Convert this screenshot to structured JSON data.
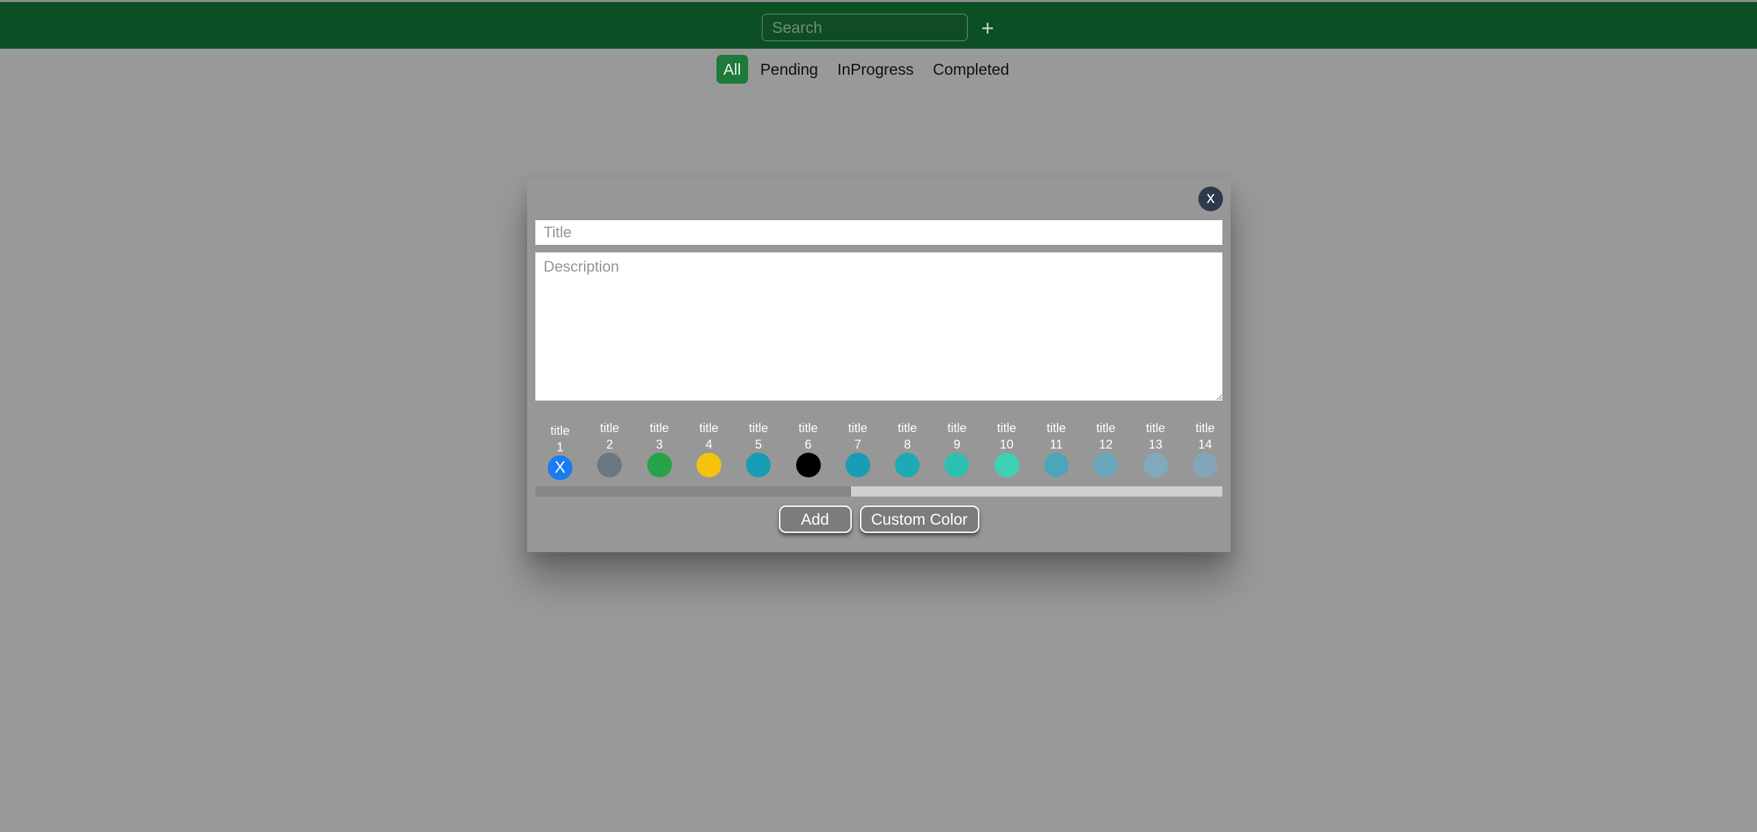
{
  "header": {
    "search_placeholder": "Search",
    "add_label": "+"
  },
  "filters": [
    {
      "label": "All",
      "active": true
    },
    {
      "label": "Pending",
      "active": false
    },
    {
      "label": "InProgress",
      "active": false
    },
    {
      "label": "Completed",
      "active": false
    }
  ],
  "modal": {
    "close_label": "x",
    "title_placeholder": "Title",
    "description_placeholder": "Description",
    "colors": [
      {
        "title": "title 1",
        "color": "#1a7cf0",
        "selected": true,
        "mark": "X"
      },
      {
        "title": "title 2",
        "color": "#6c7782"
      },
      {
        "title": "title 3",
        "color": "#26a348"
      },
      {
        "title": "title 4",
        "color": "#f5c20e"
      },
      {
        "title": "title 5",
        "color": "#169db5"
      },
      {
        "title": "title 6",
        "color": "#000000"
      },
      {
        "title": "title 7",
        "color": "#179db6"
      },
      {
        "title": "title 8",
        "color": "#1eaab4"
      },
      {
        "title": "title 9",
        "color": "#2ebfb0"
      },
      {
        "title": "title 10",
        "color": "#3fd1b5"
      },
      {
        "title": "title 11",
        "color": "#4aa6b8"
      },
      {
        "title": "title 12",
        "color": "#6aa6bc"
      },
      {
        "title": "title 13",
        "color": "#80a9bc"
      },
      {
        "title": "title 14",
        "color": "#83a6bb"
      }
    ],
    "scroll_position": 0.46,
    "add_button": "Add",
    "custom_color_button": "Custom Color"
  },
  "colors": {
    "topbar": "#0d4f25",
    "active_tab": "#1d7a3a",
    "overlay": "#999999"
  }
}
